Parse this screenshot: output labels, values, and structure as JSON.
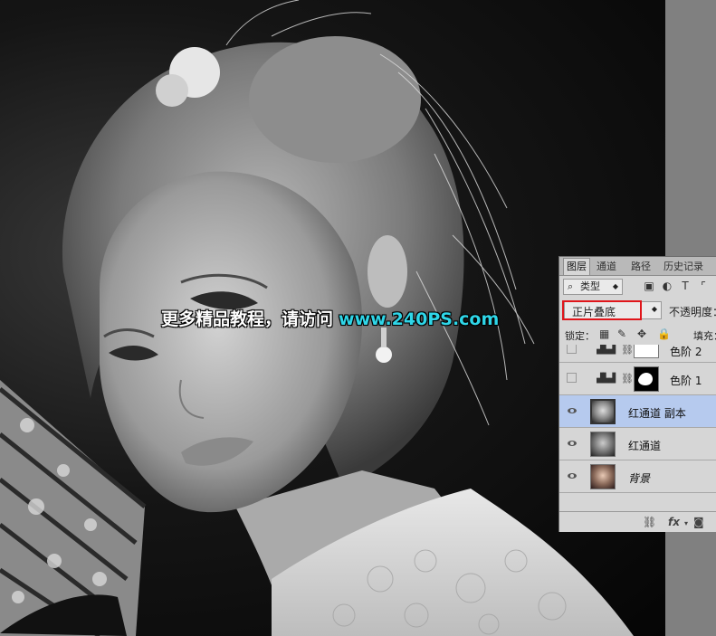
{
  "watermark": {
    "text_cn": "更多精品教程，请访问",
    "url": "www.240PS.com"
  },
  "layers_panel": {
    "tabs": [
      {
        "label": "图层",
        "active": true
      },
      {
        "label": "通道",
        "active": false
      },
      {
        "label": "路径",
        "active": false
      },
      {
        "label": "历史记录",
        "active": false
      }
    ],
    "filter": {
      "icon": "search-icon",
      "label": "类型"
    },
    "blend_mode": "正片叠底",
    "opacity_label": "不透明度：",
    "lock_label": "锁定：",
    "fill_label": "填充：",
    "layers": [
      {
        "name": "色阶 2",
        "visible": false,
        "type": "adjustment",
        "selected": false
      },
      {
        "name": "色阶 1",
        "visible": false,
        "type": "adjustment",
        "selected": false
      },
      {
        "name": "红通道 副本",
        "visible": true,
        "type": "pixel",
        "selected": true
      },
      {
        "name": "红通道",
        "visible": true,
        "type": "pixel",
        "selected": false
      },
      {
        "name": "背景",
        "visible": true,
        "type": "background",
        "selected": false
      }
    ],
    "bottom_icons": [
      "link-icon",
      "fx-icon",
      "mask-icon"
    ],
    "fx_label": "fx",
    "highlight_color": "#e0161b",
    "selected_color": "#b6caee"
  }
}
